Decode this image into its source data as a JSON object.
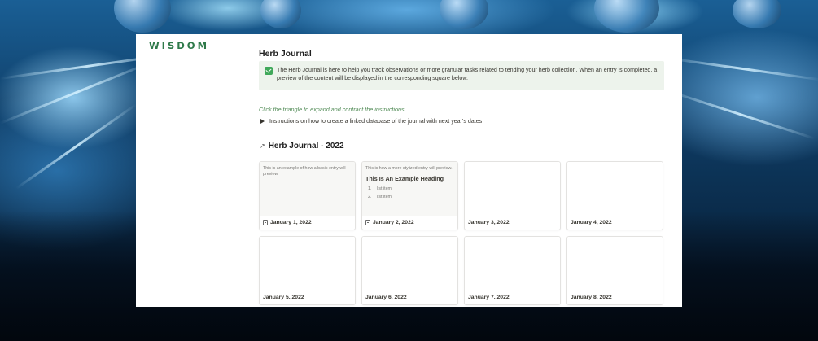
{
  "brand": "WISDOM",
  "page": {
    "title": "Herb Journal",
    "callout": "The Herb Journal is here to help you track observations or more granular tasks related to tending your herb collection. When an entry is completed, a preview of the content will be displayed in the corresponding square below.",
    "hint": "Click the triangle to expand and contract the instructions",
    "toggle_label": "Instructions on how to create a linked database of the journal with next year's dates"
  },
  "database": {
    "title": "Herb Journal - 2022",
    "cards": [
      {
        "date": "January 1, 2022",
        "has_icon": true,
        "preview_text": "This is an example of how a basic entry will preview."
      },
      {
        "date": "January 2, 2022",
        "has_icon": true,
        "preview_text": "This is how a more stylized entry will preview.",
        "preview_heading": "This Is An Example Heading",
        "preview_list": [
          {
            "num": "1.",
            "text": "list item"
          },
          {
            "num": "2.",
            "text": "list item"
          }
        ]
      },
      {
        "date": "January 3, 2022"
      },
      {
        "date": "January 4, 2022"
      },
      {
        "date": "January 5, 2022"
      },
      {
        "date": "January 6, 2022"
      },
      {
        "date": "January 7, 2022"
      },
      {
        "date": "January 8, 2022"
      }
    ]
  },
  "colors": {
    "brand": "#2f7a4a",
    "callout_bg": "#edf3ec",
    "hint": "#4f8a54"
  }
}
